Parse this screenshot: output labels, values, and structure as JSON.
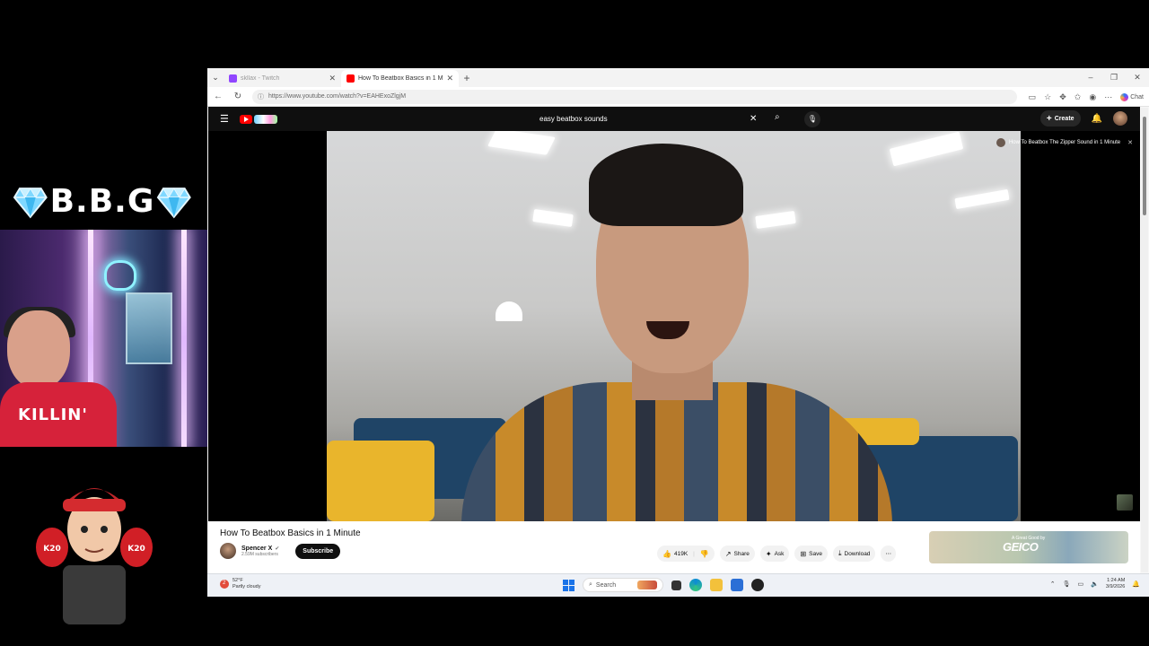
{
  "overlay": {
    "title": "B.B.G",
    "webcam_text": "KILLIN'",
    "avatar_glove_left": "K20",
    "avatar_glove_right": "K20"
  },
  "browser": {
    "tabs": [
      {
        "label": "skllax - Twitch",
        "active": false,
        "color": "#9146ff"
      },
      {
        "label": "How To Beatbox Basics in 1 M",
        "active": true,
        "color": "#ff0000"
      }
    ],
    "new_tab": "+",
    "url": "https://www.youtube.com/watch?v=EAHExoZlgjM",
    "chat_label": "Chat",
    "window_controls": [
      "–",
      "❐",
      "✕"
    ]
  },
  "youtube": {
    "search_query": "easy beatbox sounds",
    "create_label": "Create",
    "next_up": "How To Beatbox The Zipper Sound in 1 Minute",
    "video_title": "How To Beatbox Basics in 1 Minute",
    "channel_name": "Spencer X",
    "subscribers": "2.59M subscribers",
    "subscribe_label": "Subscribe",
    "like_count": "419K",
    "actions": [
      {
        "icon": "↗",
        "label": "Share"
      },
      {
        "icon": "✦",
        "label": "Ask"
      },
      {
        "icon": "⊞",
        "label": "Save"
      },
      {
        "icon": "⤓",
        "label": "Download"
      }
    ],
    "ad_brand": "GEICO",
    "ad_tagline": "A Great Good by"
  },
  "taskbar": {
    "weather_temp": "52°F",
    "weather_desc": "Partly cloudy",
    "weather_badge": "2",
    "search_placeholder": "Search",
    "time": "1:24 AM",
    "date": "3/9/2026"
  },
  "colors": {
    "youtube_red": "#ff0000",
    "yt_dark": "#0f0f0f",
    "windows_blue": "#1a73e8"
  }
}
